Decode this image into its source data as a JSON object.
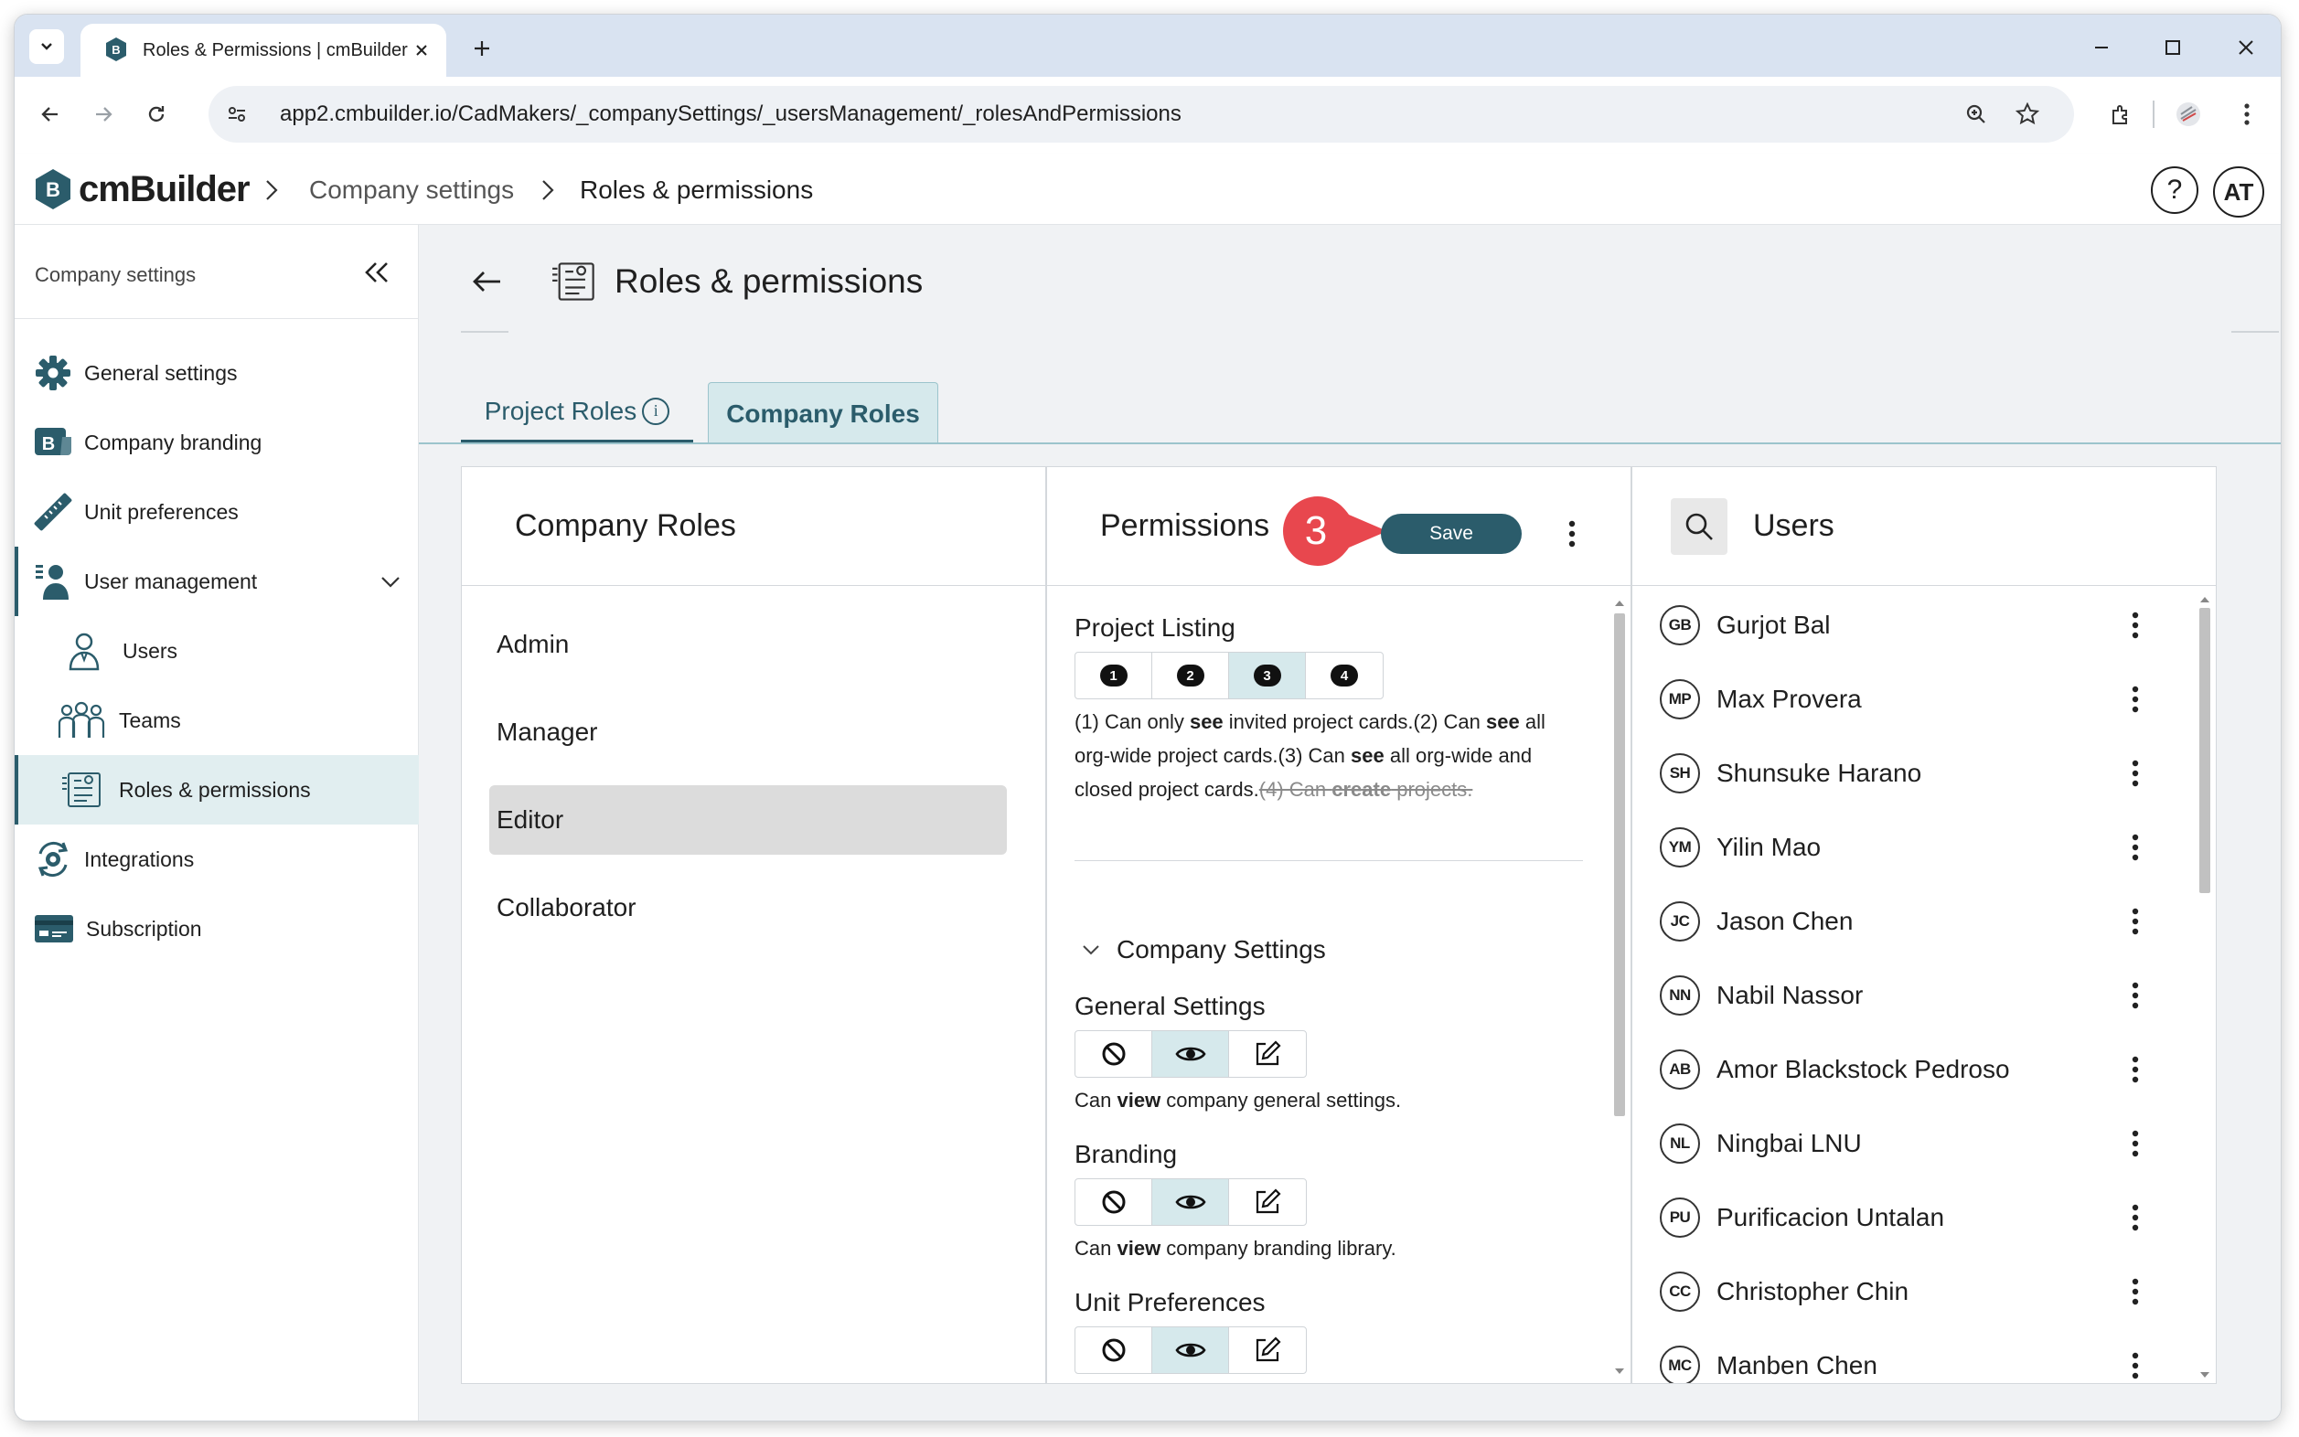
{
  "browser": {
    "tab_title": "Roles & Permissions | cmBuilder",
    "url": "app2.cmbuilder.io/CadMakers/_companySettings/_usersManagement/_rolesAndPermissions"
  },
  "header": {
    "logo_text": "cmBuilder",
    "breadcrumb": [
      "Company settings",
      "Roles & permissions"
    ],
    "help": "?",
    "avatar": "AT"
  },
  "sidebar": {
    "title": "Company settings",
    "items": [
      {
        "label": "General settings"
      },
      {
        "label": "Company branding"
      },
      {
        "label": "Unit preferences"
      },
      {
        "label": "User management"
      },
      {
        "label": "Users"
      },
      {
        "label": "Teams"
      },
      {
        "label": "Roles & permissions"
      },
      {
        "label": "Integrations"
      },
      {
        "label": "Subscription"
      }
    ]
  },
  "page": {
    "title": "Roles & permissions",
    "tabs": [
      {
        "label": "Project Roles"
      },
      {
        "label": "Company Roles"
      }
    ]
  },
  "roles_panel": {
    "title": "Company Roles",
    "roles": [
      "Admin",
      "Manager",
      "Editor",
      "Collaborator"
    ],
    "selected": "Editor"
  },
  "permissions_panel": {
    "title": "Permissions",
    "step_marker": "3",
    "save_label": "Save",
    "project_listing": {
      "label": "Project Listing",
      "options": [
        "1",
        "2",
        "3",
        "4"
      ],
      "selected": "3",
      "desc_lines": [
        [
          {
            "t": "(1) Can only "
          },
          {
            "t": "see",
            "b": true
          },
          {
            "t": " invited project cards.(2) Can "
          },
          {
            "t": "see",
            "b": true
          },
          {
            "t": " all"
          }
        ],
        [
          {
            "t": "org-wide project cards.(3) Can "
          },
          {
            "t": "see",
            "b": true
          },
          {
            "t": " all org-wide and"
          }
        ],
        [
          {
            "t": "closed project cards."
          },
          {
            "t": "(4) Can ",
            "s": true
          },
          {
            "t": "create",
            "s": true,
            "b": true
          },
          {
            "t": " projects.",
            "s": true
          }
        ]
      ]
    },
    "section_title": "Company Settings",
    "settings": [
      {
        "label": "General Settings",
        "desc": [
          {
            "t": "Can "
          },
          {
            "t": "view",
            "b": true
          },
          {
            "t": " company general settings."
          }
        ]
      },
      {
        "label": "Branding",
        "desc": [
          {
            "t": "Can "
          },
          {
            "t": "view",
            "b": true
          },
          {
            "t": " company branding library."
          }
        ]
      },
      {
        "label": "Unit Preferences",
        "desc": []
      }
    ]
  },
  "users_panel": {
    "title": "Users",
    "users": [
      {
        "initials": "GB",
        "name": "Gurjot Bal"
      },
      {
        "initials": "MP",
        "name": "Max Provera"
      },
      {
        "initials": "SH",
        "name": "Shunsuke Harano"
      },
      {
        "initials": "YM",
        "name": "Yilin Mao"
      },
      {
        "initials": "JC",
        "name": "Jason Chen"
      },
      {
        "initials": "NN",
        "name": "Nabil Nassor"
      },
      {
        "initials": "AB",
        "name": "Amor Blackstock Pedroso"
      },
      {
        "initials": "NL",
        "name": "Ningbai LNU"
      },
      {
        "initials": "PU",
        "name": "Purificacion Untalan"
      },
      {
        "initials": "CC",
        "name": "Christopher Chin"
      },
      {
        "initials": "MC",
        "name": "Manben Chen"
      }
    ]
  },
  "colors": {
    "accent": "#2b5c6b",
    "selected_tab": "#d6e9ec",
    "step_marker": "#e8474e"
  }
}
